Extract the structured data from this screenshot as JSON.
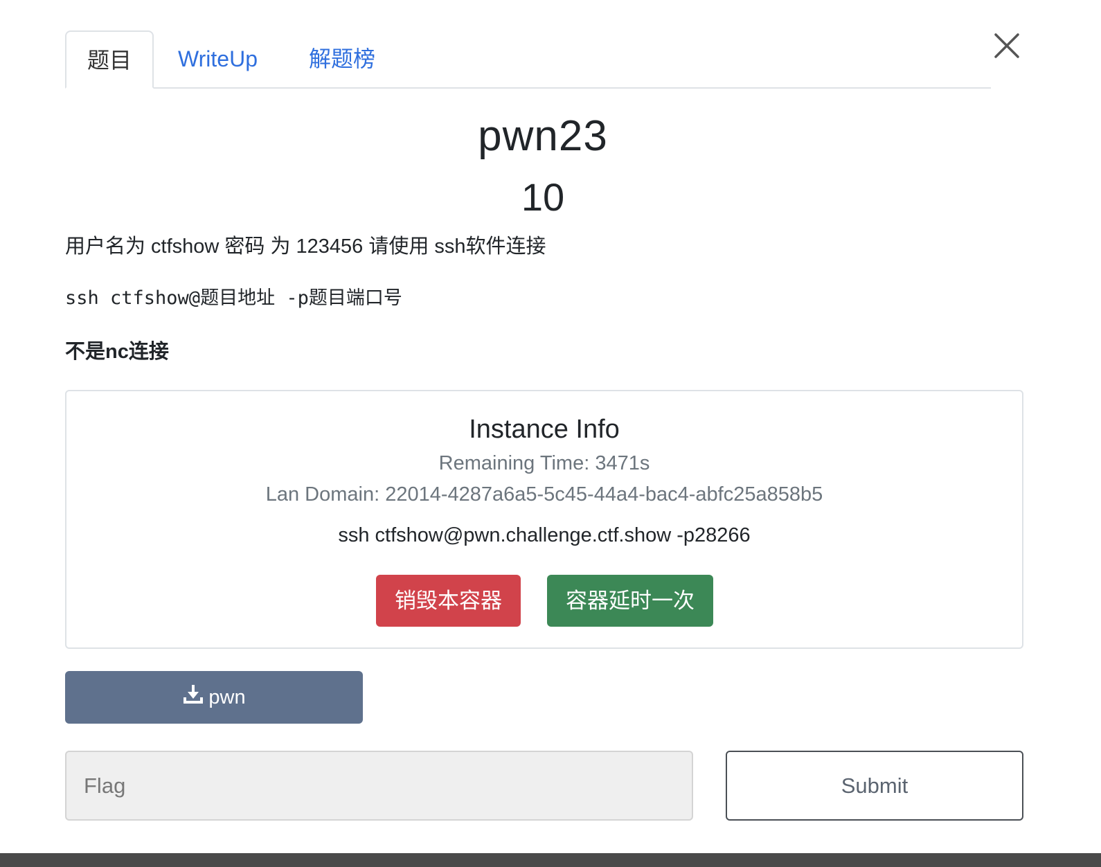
{
  "tabs": [
    {
      "label": "题目",
      "active": true
    },
    {
      "label": "WriteUp",
      "active": false
    },
    {
      "label": "解题榜",
      "active": false
    }
  ],
  "close_icon": "close-icon",
  "challenge": {
    "name": "pwn23",
    "points": "10",
    "description": [
      "用户名为 ctfshow 密码 为 123456 请使用 ssh软件连接",
      "ssh ctfshow@题目地址 -p题目端口号",
      "不是nc连接"
    ]
  },
  "instance": {
    "title": "Instance Info",
    "remaining": "Remaining Time: 3471s",
    "lan_domain": "Lan Domain: 22014-4287a6a5-5c45-44a4-bac4-abfc25a858b5",
    "ssh_command": "ssh ctfshow@pwn.challenge.ctf.show -p28266",
    "destroy_label": "销毁本容器",
    "extend_label": "容器延时一次"
  },
  "download": {
    "label": "pwn",
    "icon": "download-icon"
  },
  "flag": {
    "placeholder": "Flag",
    "value": ""
  },
  "submit_label": "Submit",
  "colors": {
    "tab_link": "#2f6fde",
    "danger": "#d1434b",
    "success": "#3c8856",
    "download": "#5f718d",
    "muted": "#6c757d"
  }
}
